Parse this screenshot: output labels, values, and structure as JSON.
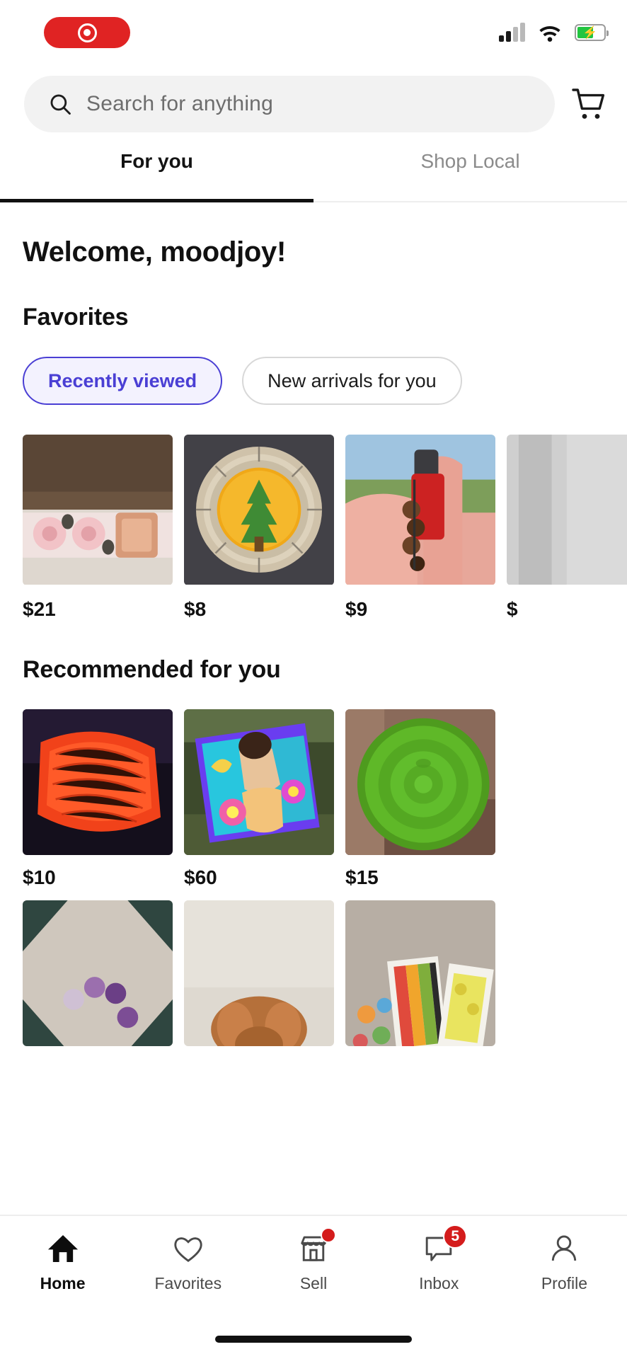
{
  "status_bar": {
    "recording_pill_icon": "record-target-icon",
    "signal_icon": "cellular-signal-icon",
    "signal_bars_active": 2,
    "signal_bars_total": 4,
    "wifi_icon": "wifi-icon",
    "battery_icon": "battery-charging-icon",
    "battery_level_percent": 62
  },
  "search": {
    "placeholder": "Search for anything",
    "icon": "search-icon",
    "cart_icon": "shopping-cart-icon"
  },
  "tabs": [
    {
      "label": "For you",
      "active": true
    },
    {
      "label": "Shop Local",
      "active": false
    }
  ],
  "main": {
    "welcome": "Welcome, moodjoy!",
    "favorites": {
      "title": "Favorites",
      "chips": [
        {
          "label": "Recently viewed",
          "active": true
        },
        {
          "label": "New arrivals for you",
          "active": false
        }
      ],
      "items": [
        {
          "price": "$21",
          "alt": "floral pink dog collar with rose gold buckle"
        },
        {
          "price": "$8",
          "alt": "round woven wall hanging with painted tree"
        },
        {
          "price": "$9",
          "alt": "wooden bead keychain held in hand"
        },
        {
          "price": "$",
          "alt": "partially visible item",
          "partial": true
        }
      ]
    },
    "recommended": {
      "title": "Recommended for you",
      "items": [
        {
          "price": "$10",
          "alt": "orange knitted cowl scarf"
        },
        {
          "price": "$60",
          "alt": "colorful painted canvas artwork"
        },
        {
          "price": "$15",
          "alt": "green plastic bowl top view"
        }
      ],
      "next_row_items": [
        {
          "alt": "purple beaded bracelet on patterned rug"
        },
        {
          "alt": "brown dog lying on white fur rug"
        },
        {
          "alt": "scrapbook paper sticker sheets on carpet"
        }
      ]
    }
  },
  "bottom_nav": [
    {
      "label": "Home",
      "icon": "home-icon",
      "active": true,
      "badge": null,
      "dot": false
    },
    {
      "label": "Favorites",
      "icon": "heart-icon",
      "active": false,
      "badge": null,
      "dot": false
    },
    {
      "label": "Sell",
      "icon": "storefront-icon",
      "active": false,
      "badge": null,
      "dot": true
    },
    {
      "label": "Inbox",
      "icon": "speech-bubble-icon",
      "active": false,
      "badge": "5",
      "dot": false
    },
    {
      "label": "Profile",
      "icon": "person-icon",
      "active": false,
      "badge": null,
      "dot": false
    }
  ],
  "colors": {
    "accent_purple": "#4a3fd4",
    "badge_red": "#d41c1c",
    "record_red": "#e02323",
    "battery_green": "#22c540"
  }
}
